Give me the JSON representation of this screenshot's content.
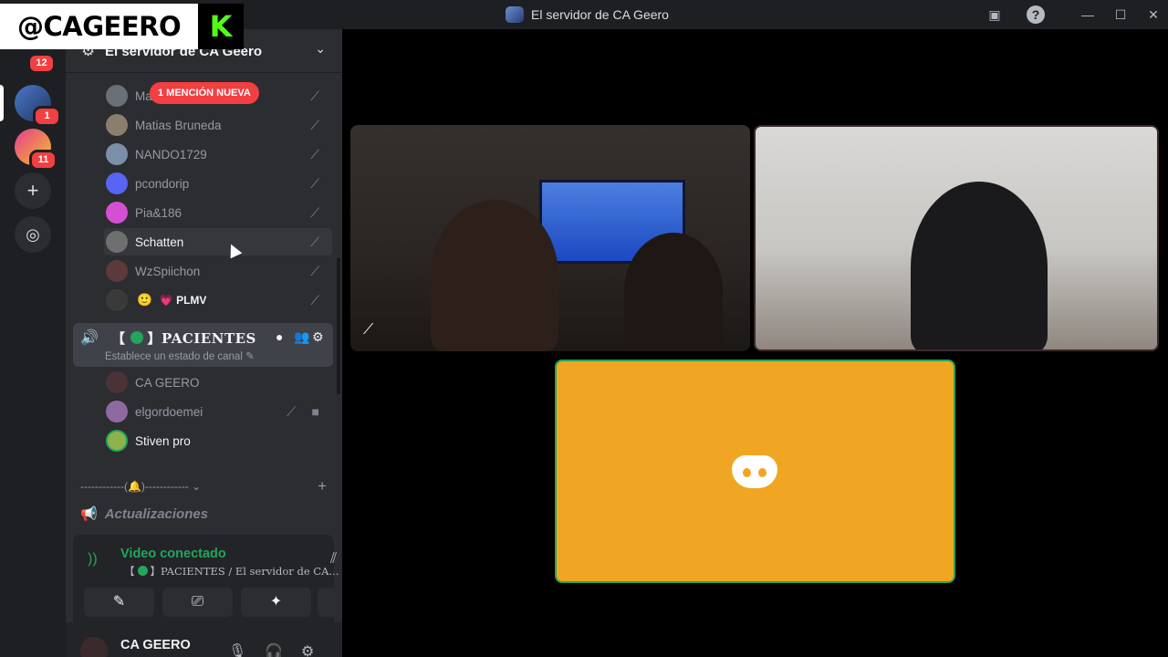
{
  "window": {
    "title": "El servidor de CA Geero",
    "controls": {
      "minimize": "—",
      "maximize": "☐",
      "close": "✕"
    }
  },
  "watermark": {
    "handle": "@CAGEERO",
    "logo_letter": "K"
  },
  "rail": {
    "top_badge": "12",
    "servers": [
      {
        "badge": "1"
      },
      {
        "badge": "11"
      }
    ],
    "add_icon": "+",
    "discover_icon": "◎"
  },
  "server": {
    "name": "El servidor de CA Geero",
    "chevron": "⌄"
  },
  "mention_pill": "1 MENCIÓN NUEVA",
  "voice_users_top": [
    {
      "name": "Ma",
      "color": "#6b6f78"
    },
    {
      "name": "Matias Bruneda",
      "color": "#8a7f6c"
    },
    {
      "name": "NANDO1729",
      "color": "#7c8fa8"
    },
    {
      "name": "pcondorip",
      "color": "#5865f2"
    },
    {
      "name": "Pia&186",
      "color": "#d44fd2"
    },
    {
      "name": "Schatten",
      "color": "#6f6f6f"
    },
    {
      "name": "WzSpiichon",
      "color": "#5a3a3a"
    },
    {
      "name": "💗 PLMV",
      "color": "#3a3a3a",
      "prefix": "🙂"
    }
  ],
  "active_channel": {
    "name_left": "【",
    "name_right": "】PACIENTES",
    "status": "Establece un estado de canal"
  },
  "voice_users_channel": [
    {
      "name": "CA GEERO",
      "color": "#4a3236"
    },
    {
      "name": "elgordoemei",
      "color": "#8e6aa0"
    },
    {
      "name": "Stiven pro",
      "color": "#8db24b"
    }
  ],
  "category": {
    "label": "------------(🔔)------------ ⌄",
    "plus": "+"
  },
  "channel_updates": {
    "name": "Actualizaciones"
  },
  "voice_panel": {
    "status": "Video conectado",
    "channel_left": "【",
    "channel_right": "】PACIENTES / El servidor de CA...",
    "buttons": [
      "✎",
      "⎚",
      "✦",
      "✧"
    ]
  },
  "user": {
    "name": "CA GEERO"
  },
  "colors": {
    "accent_green": "#23a55a",
    "mention_red": "#f23f42",
    "tile_orange": "#f0a623"
  }
}
